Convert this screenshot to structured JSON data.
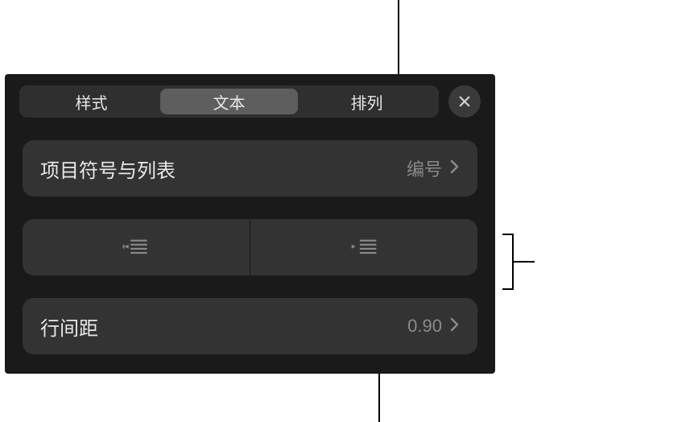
{
  "tabs": {
    "style": "样式",
    "text": "文本",
    "arrange": "排列"
  },
  "rows": {
    "bullets_lists": {
      "label": "项目符号与列表",
      "value": "编号"
    },
    "line_spacing": {
      "label": "行间距",
      "value": "0.90"
    }
  },
  "icons": {
    "outdent": "outdent-icon",
    "indent": "indent-icon",
    "close": "close-icon",
    "chevron": "chevron-right-icon"
  }
}
